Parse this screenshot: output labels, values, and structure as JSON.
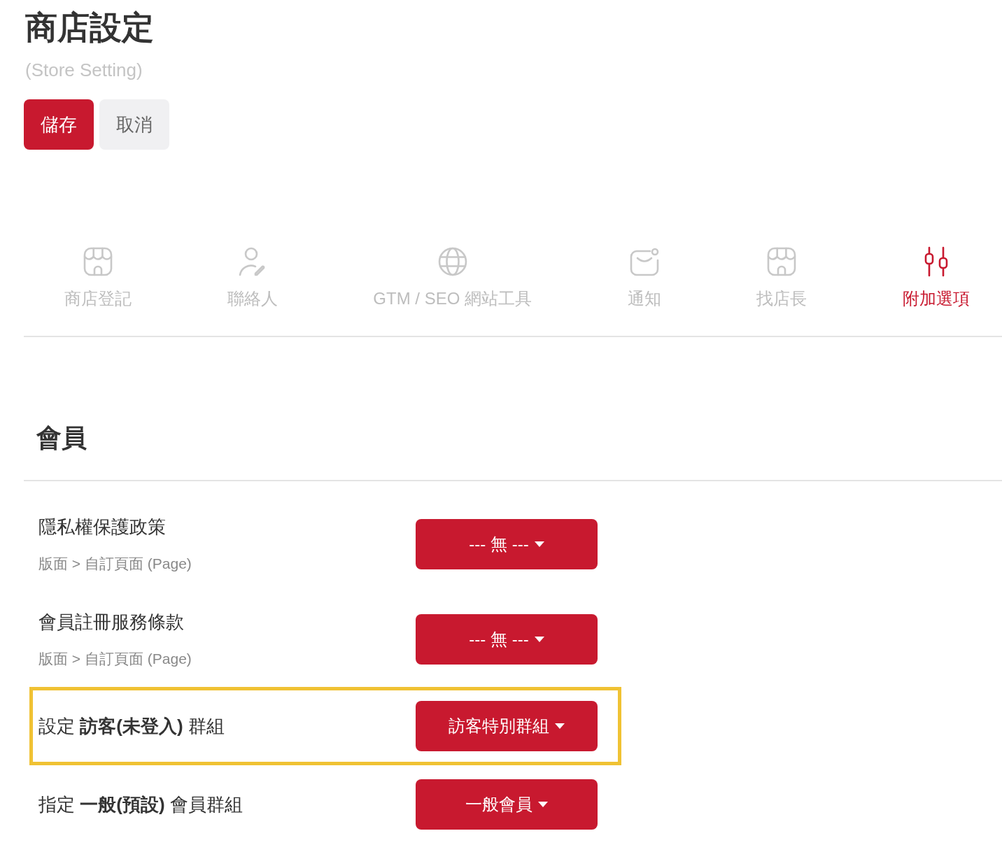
{
  "header": {
    "title": "商店設定",
    "subtitle": "(Store Setting)"
  },
  "actions": [
    {
      "label": "儲存",
      "kind": "primary"
    },
    {
      "label": "取消",
      "kind": "secondary"
    }
  ],
  "tabs": [
    {
      "label": "商店登記",
      "selected": false
    },
    {
      "label": "聯絡人",
      "selected": false
    },
    {
      "label": "GTM / SEO 網站工具",
      "selected": false
    },
    {
      "label": "通知",
      "selected": false
    },
    {
      "label": "找店長",
      "selected": false
    },
    {
      "label": "附加選項",
      "selected": true
    }
  ],
  "section": {
    "title": "會員",
    "rows": [
      {
        "label": "隱私權保護政策",
        "hint": "版面 > 自訂頁面 (Page)",
        "value": "--- 無 ---",
        "highlighted": false
      },
      {
        "label": "會員註冊服務條款",
        "hint": "版面 > 自訂頁面 (Page)",
        "value": "--- 無 ---",
        "highlighted": false
      },
      {
        "label": "設定 **訪客(未登入)** 群組",
        "value": "訪客特別群組",
        "highlighted": true
      },
      {
        "label": "指定 **一般(預設)** 會員群組",
        "value": "一般會員",
        "highlighted": false
      }
    ]
  }
}
